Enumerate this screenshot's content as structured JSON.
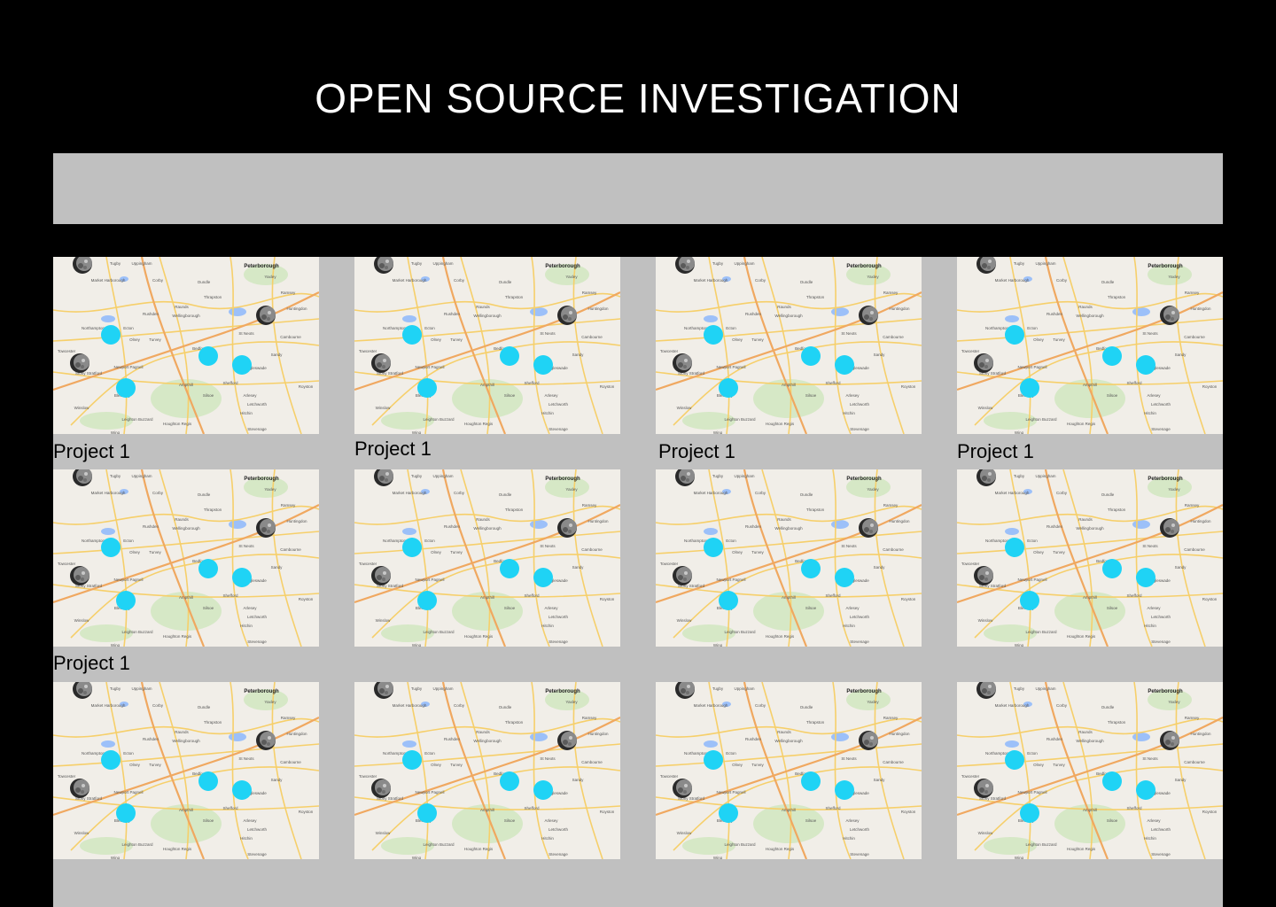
{
  "header": {
    "title": "OPEN SOURCE INVESTIGATION"
  },
  "search": {
    "value": ""
  },
  "map": {
    "towns": [
      "Peterborough",
      "Uppingham",
      "Tugby",
      "Market Harborough",
      "Corby",
      "Oundle",
      "Thrapston",
      "Wellingborough",
      "Northampton",
      "Ecton",
      "Olney",
      "Turvey",
      "Bedford",
      "Towcester",
      "Newport Pagnell",
      "Stony Stratford",
      "Ampthill",
      "Shefford",
      "Biggleswade",
      "Silsoe",
      "Arlesey",
      "Letchworth",
      "Hitchin",
      "Leighton Buzzard",
      "Houghton Regis",
      "Stevenage",
      "Winslow",
      "Wing",
      "St Neots",
      "Cambourne",
      "Ramsey",
      "Yaxley",
      "Rushden",
      "Raunds",
      "Sandy",
      "Royston",
      "Huntingdon",
      "Bletchley"
    ],
    "marker_color": "#1fd3f5",
    "icon": "moon-marker-icon"
  },
  "projects": [
    {
      "label": "Project 1"
    },
    {
      "label": "Project 1"
    },
    {
      "label": "Project 1"
    },
    {
      "label": "Project 1"
    },
    {
      "label": "Project 1"
    },
    {
      "label": ""
    },
    {
      "label": ""
    },
    {
      "label": ""
    },
    {
      "label": ""
    },
    {
      "label": ""
    },
    {
      "label": ""
    },
    {
      "label": ""
    }
  ]
}
